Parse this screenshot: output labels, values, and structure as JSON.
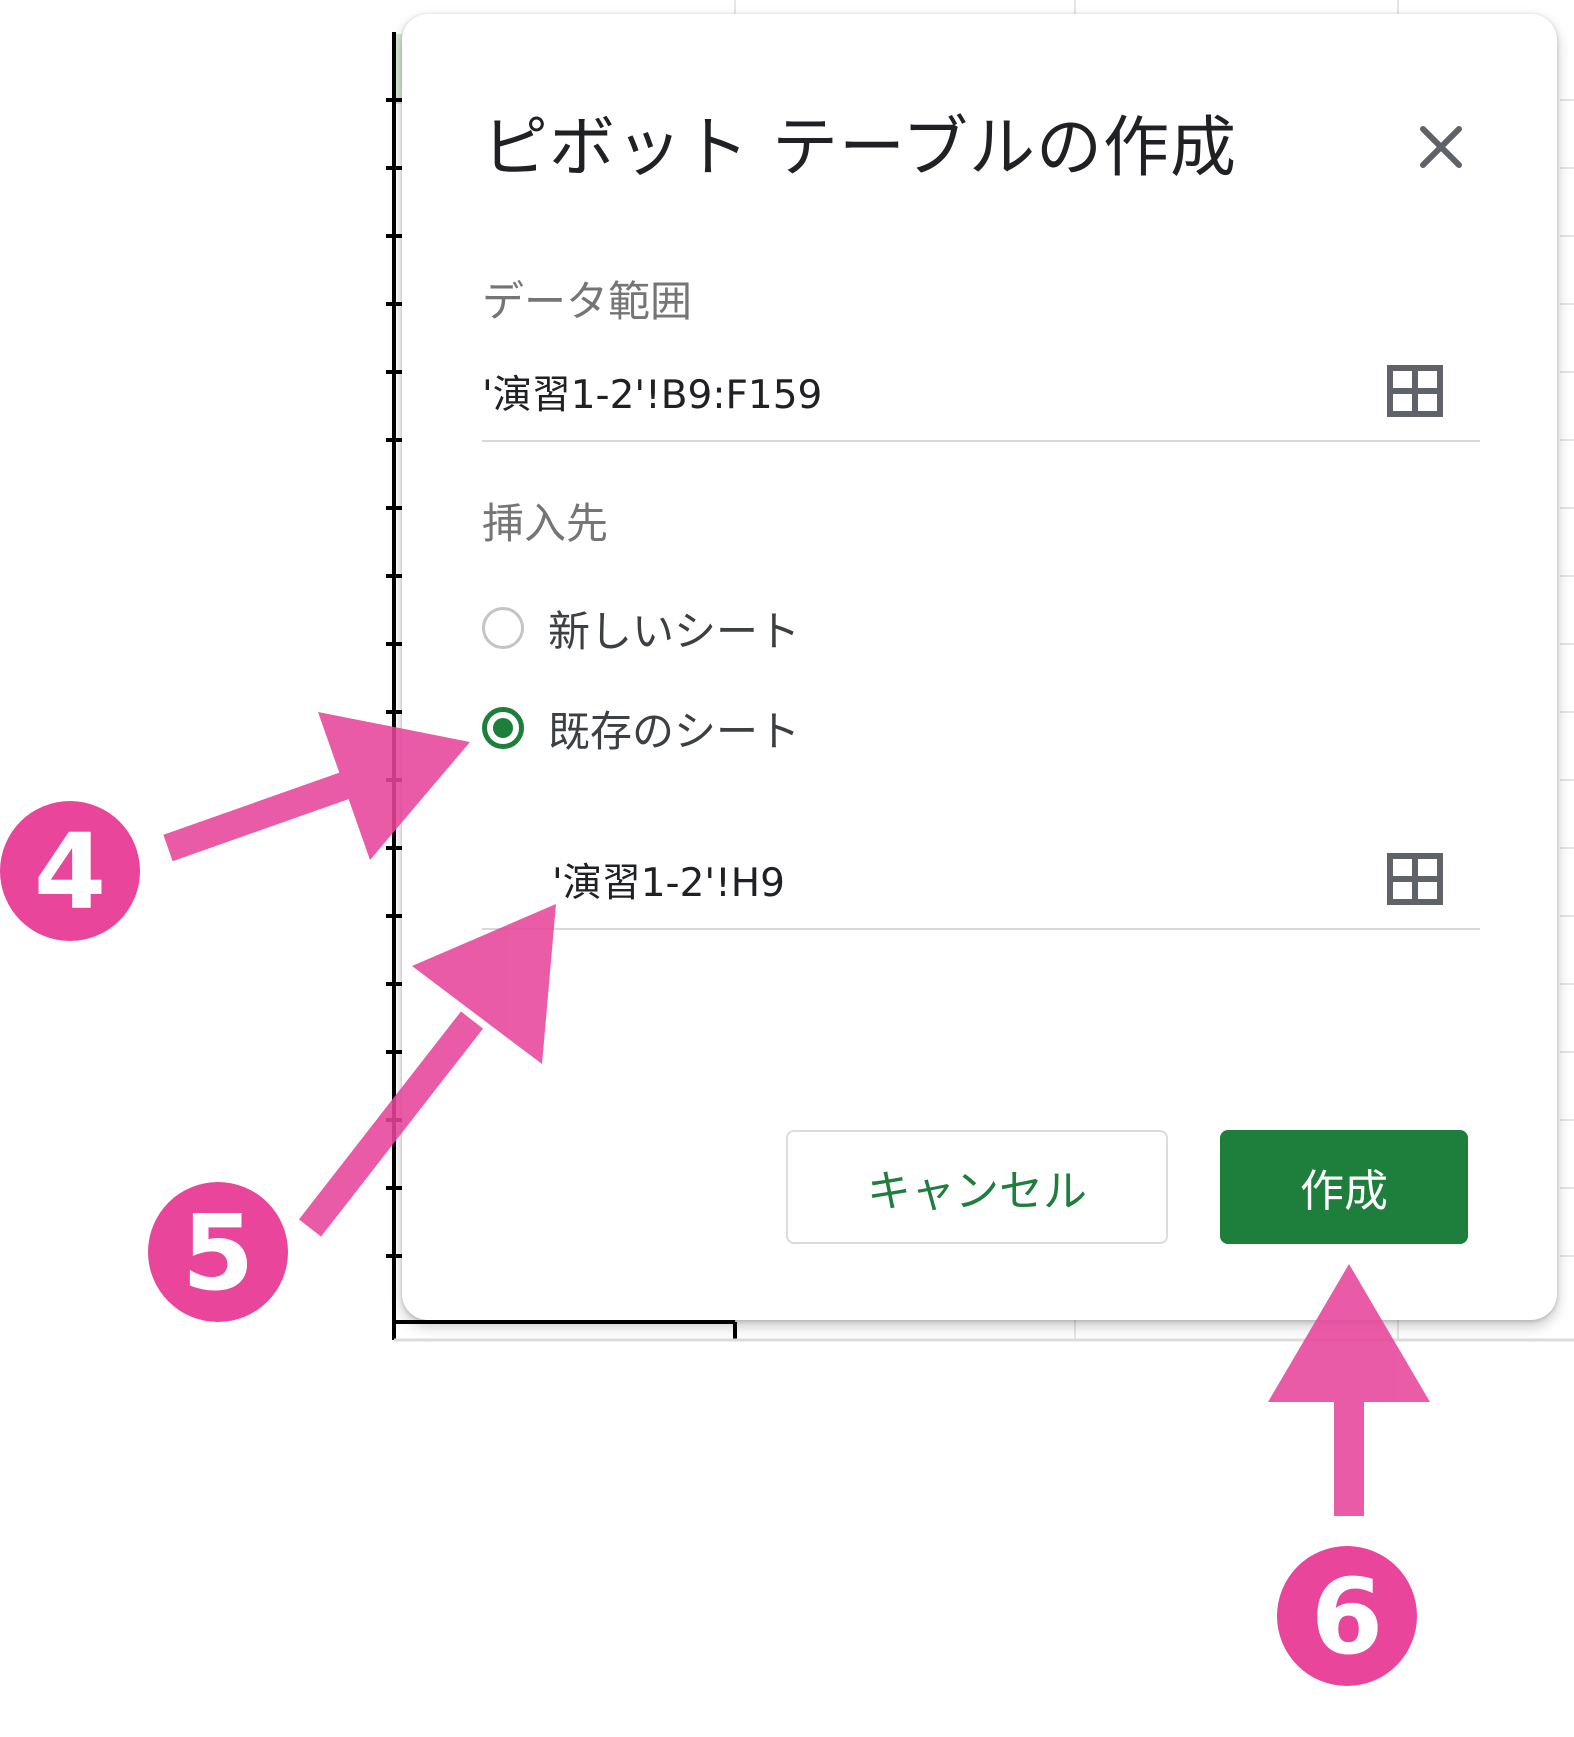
{
  "dialog": {
    "title": "ピボット テーブルの作成",
    "close_icon": "close-icon",
    "data_range": {
      "label": "データ範囲",
      "value": "'演習1-2'!B9:F159",
      "icon": "grid-icon"
    },
    "insert_to": {
      "label": "挿入先",
      "options": [
        {
          "label": "新しいシート",
          "selected": false
        },
        {
          "label": "既存のシート",
          "selected": true
        }
      ],
      "location_value": "'演習1-2'!H9",
      "icon": "grid-icon"
    },
    "buttons": {
      "cancel": "キャンセル",
      "create": "作成"
    }
  },
  "annotations": {
    "step_4": "4",
    "step_5": "5",
    "step_6": "6"
  },
  "colors": {
    "accent_green": "#1e7e3c",
    "annotation_pink": "#e8459b"
  }
}
